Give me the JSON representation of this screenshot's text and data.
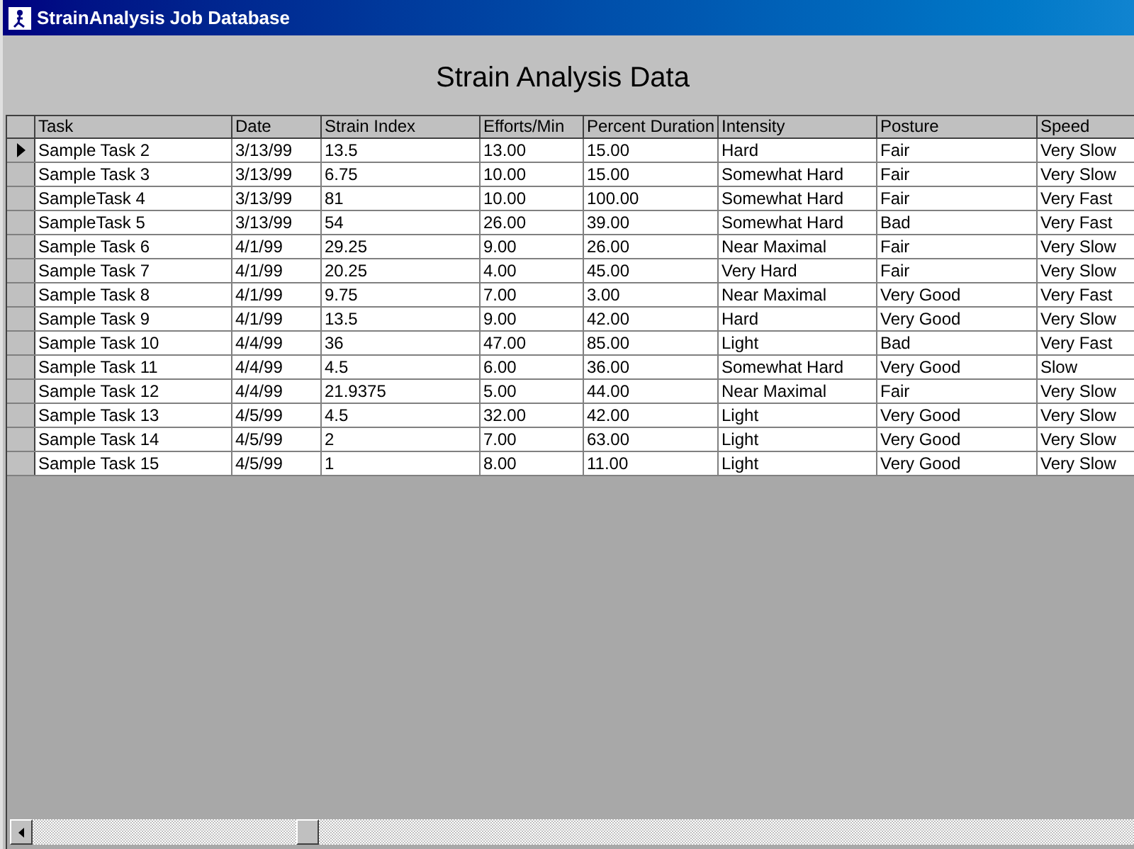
{
  "window": {
    "title": "StrainAnalysis Job Database"
  },
  "heading": "Strain Analysis Data",
  "table": {
    "columns": [
      "Task",
      "Date",
      "Strain Index",
      "Efforts/Min",
      "Percent Duration",
      "Intensity",
      "Posture",
      "Speed"
    ],
    "rows": [
      {
        "selected": true,
        "cells": [
          "Sample Task 2",
          "3/13/99",
          "13.5",
          "13.00",
          "15.00",
          "Hard",
          "Fair",
          "Very Slow"
        ]
      },
      {
        "selected": false,
        "cells": [
          "Sample Task 3",
          "3/13/99",
          "6.75",
          "10.00",
          "15.00",
          "Somewhat Hard",
          "Fair",
          "Very Slow"
        ]
      },
      {
        "selected": false,
        "cells": [
          "SampleTask 4",
          "3/13/99",
          "81",
          "10.00",
          "100.00",
          "Somewhat Hard",
          "Fair",
          "Very Fast"
        ]
      },
      {
        "selected": false,
        "cells": [
          "SampleTask 5",
          "3/13/99",
          "54",
          "26.00",
          "39.00",
          "Somewhat Hard",
          "Bad",
          "Very Fast"
        ]
      },
      {
        "selected": false,
        "cells": [
          "Sample Task 6",
          "4/1/99",
          "29.25",
          "9.00",
          "26.00",
          "Near Maximal",
          "Fair",
          "Very Slow"
        ]
      },
      {
        "selected": false,
        "cells": [
          "Sample Task 7",
          "4/1/99",
          "20.25",
          "4.00",
          "45.00",
          "Very Hard",
          "Fair",
          "Very Slow"
        ]
      },
      {
        "selected": false,
        "cells": [
          "Sample Task 8",
          "4/1/99",
          "9.75",
          "7.00",
          "3.00",
          "Near Maximal",
          "Very Good",
          "Very Fast"
        ]
      },
      {
        "selected": false,
        "cells": [
          "Sample Task 9",
          "4/1/99",
          "13.5",
          "9.00",
          "42.00",
          "Hard",
          "Very Good",
          "Very Slow"
        ]
      },
      {
        "selected": false,
        "cells": [
          "Sample Task 10",
          "4/4/99",
          "36",
          "47.00",
          "85.00",
          "Light",
          "Bad",
          "Very Fast"
        ]
      },
      {
        "selected": false,
        "cells": [
          "Sample Task 11",
          "4/4/99",
          "4.5",
          "6.00",
          "36.00",
          "Somewhat Hard",
          "Very Good",
          "Slow"
        ]
      },
      {
        "selected": false,
        "cells": [
          "Sample Task 12",
          "4/4/99",
          "21.9375",
          "5.00",
          "44.00",
          "Near Maximal",
          "Fair",
          "Very Slow"
        ]
      },
      {
        "selected": false,
        "cells": [
          "Sample Task 13",
          "4/5/99",
          "4.5",
          "32.00",
          "42.00",
          "Light",
          "Very Good",
          "Very Slow"
        ]
      },
      {
        "selected": false,
        "cells": [
          "Sample Task 14",
          "4/5/99",
          "2",
          "7.00",
          "63.00",
          "Light",
          "Very Good",
          "Very Slow"
        ]
      },
      {
        "selected": false,
        "cells": [
          "Sample Task 15",
          "4/5/99",
          "1",
          "8.00",
          "11.00",
          "Light",
          "Very Good",
          "Very Slow"
        ]
      }
    ]
  }
}
